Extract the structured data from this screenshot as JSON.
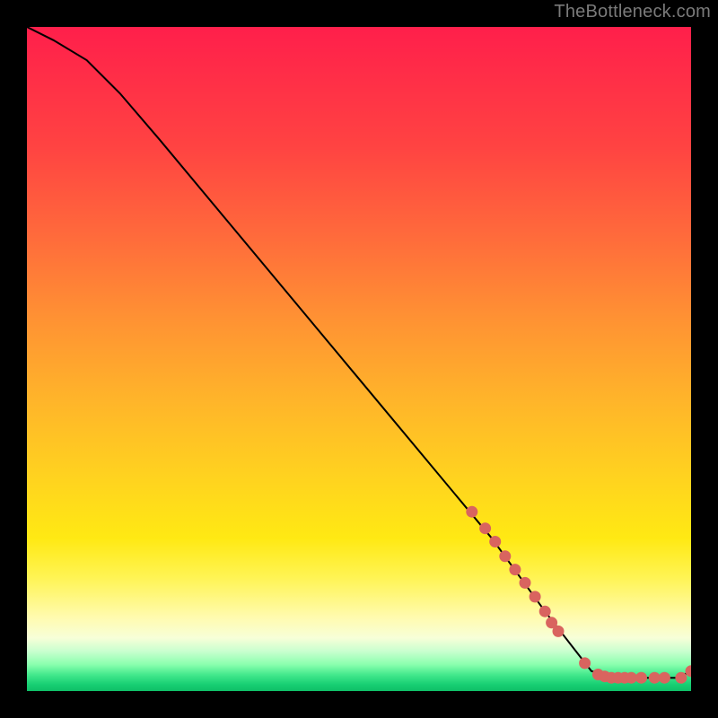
{
  "watermark": "TheBottleneck.com",
  "colors": {
    "marker": "#d9645f",
    "curve": "#000000"
  },
  "chart_data": {
    "type": "line",
    "title": "",
    "xlabel": "",
    "ylabel": "",
    "xlim": [
      0,
      100
    ],
    "ylim": [
      0,
      100
    ],
    "grid": false,
    "series": [
      {
        "name": "curve",
        "x": [
          0,
          4,
          9,
          14,
          20,
          30,
          40,
          50,
          60,
          70,
          78,
          85,
          90,
          94,
          98,
          100
        ],
        "y": [
          100,
          98,
          95,
          90,
          83,
          71,
          59,
          47,
          35,
          23,
          12,
          3,
          2,
          2,
          2,
          3
        ]
      }
    ],
    "markers": {
      "name": "highlighted-points",
      "x": [
        67,
        69,
        70.5,
        72,
        73.5,
        75,
        76.5,
        78,
        79,
        80,
        84,
        86,
        87,
        88,
        89,
        90,
        91,
        92.5,
        94.5,
        96,
        98.5,
        100
      ],
      "y": [
        27,
        24.5,
        22.5,
        20.3,
        18.3,
        16.3,
        14.2,
        12,
        10.3,
        9,
        4.2,
        2.5,
        2.2,
        2,
        2,
        2,
        2,
        2,
        2,
        2,
        2,
        3
      ]
    }
  }
}
